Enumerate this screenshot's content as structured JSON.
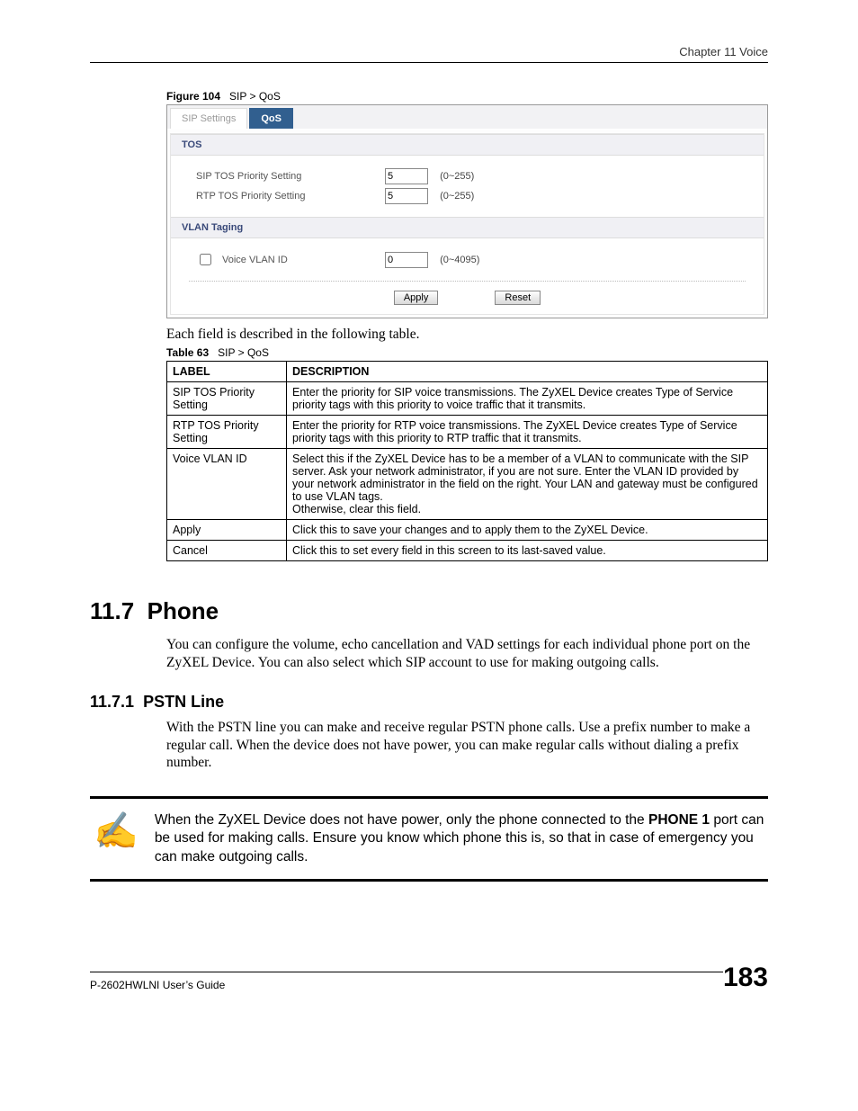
{
  "header": {
    "chapter": "Chapter 11 Voice"
  },
  "figure": {
    "label": "Figure 104",
    "title": "SIP > QoS",
    "tabs": {
      "inactive": "SIP Settings",
      "active": "QoS"
    },
    "sections": {
      "tos": {
        "head": "TOS",
        "sip_label": "SIP TOS Priority Setting",
        "sip_value": "5",
        "rtp_label": "RTP TOS Priority Setting",
        "rtp_value": "5",
        "range": "(0~255)"
      },
      "vlan": {
        "head": "VLAN Taging",
        "voice_label": "Voice VLAN ID",
        "voice_value": "0",
        "range": "(0~4095)"
      },
      "buttons": {
        "apply": "Apply",
        "reset": "Reset"
      }
    }
  },
  "after_fig_text": "Each field is described in the following table.",
  "table": {
    "label": "Table 63",
    "title": "SIP > QoS",
    "head": {
      "c1": "LABEL",
      "c2": "DESCRIPTION"
    },
    "rows": [
      {
        "c1": "SIP TOS Priority Setting",
        "c2": "Enter the priority for SIP voice transmissions. The ZyXEL Device creates Type of Service priority tags with this priority to voice traffic that it transmits."
      },
      {
        "c1": "RTP TOS Priority Setting",
        "c2": "Enter the priority for RTP voice transmissions. The ZyXEL Device creates Type of Service priority tags with this priority to RTP traffic that it transmits."
      },
      {
        "c1": "Voice VLAN ID",
        "c2": "Select this if the ZyXEL Device has to be a member of a VLAN to communicate with the SIP server. Ask your network administrator, if you are not sure. Enter the VLAN ID provided by your network administrator in the field on the right. Your LAN and gateway must be configured to use VLAN tags.\nOtherwise, clear this field."
      },
      {
        "c1": "Apply",
        "c2": "Click this to save your changes and to apply them to the ZyXEL Device."
      },
      {
        "c1": "Cancel",
        "c2": "Click this to set every field in this screen to its last-saved value."
      }
    ]
  },
  "sections": {
    "phone": {
      "num": "11.7",
      "title": "Phone",
      "body": "You can configure the volume, echo cancellation and VAD settings for each individual phone port on the ZyXEL Device. You can also select which SIP account to use for making outgoing calls."
    },
    "pstn": {
      "num": "11.7.1",
      "title": "PSTN Line",
      "body": "With the PSTN line you can make and receive regular PSTN phone calls. Use a prefix number to make a regular call. When the device does not have power, you can make regular calls without dialing a prefix number."
    }
  },
  "note": {
    "pre": "When the ZyXEL Device does not have power, only the phone connected to the ",
    "bold": "PHONE 1",
    "post": " port can be used for making calls. Ensure you know which phone this is, so that in case of emergency you can make outgoing calls."
  },
  "footer": {
    "guide": "P-2602HWLNI User’s Guide",
    "page": "183"
  }
}
